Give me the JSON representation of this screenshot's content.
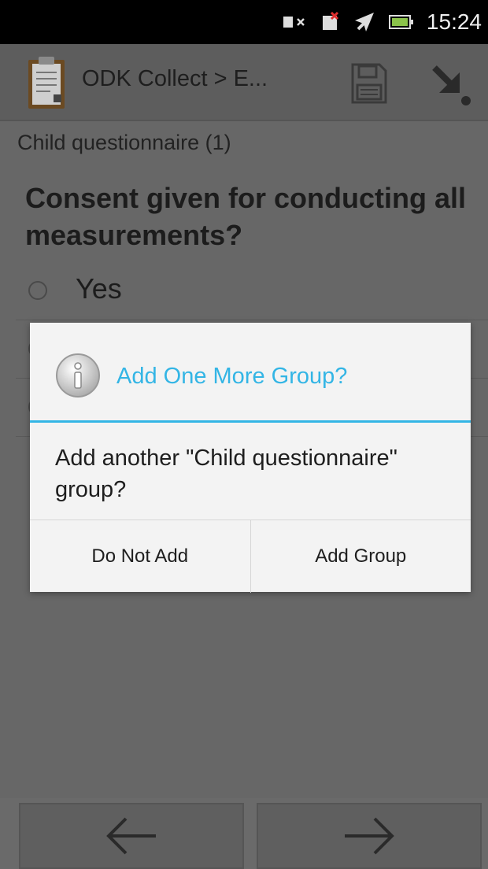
{
  "status_bar": {
    "time": "15:24",
    "icons": [
      "muted-speaker-icon",
      "no-sim-icon",
      "airplane-mode-icon",
      "battery-icon"
    ]
  },
  "action_bar": {
    "title": "ODK Collect > E...",
    "app_icon": "clipboard-icon",
    "save_icon": "save-disk-icon",
    "next_icon": "go-to-end-icon"
  },
  "form": {
    "group_label": "Child questionnaire (1)",
    "question": "Consent given for conducting all measurements?",
    "options": [
      "Yes"
    ]
  },
  "dialog": {
    "icon": "info-icon",
    "title": "Add One More Group?",
    "message": "Add another \"Child questionnaire\" group?",
    "negative_button": "Do Not Add",
    "positive_button": "Add Group",
    "accent_color": "#33b5e5"
  },
  "navigation": {
    "back_icon": "arrow-left-icon",
    "forward_icon": "arrow-right-icon"
  }
}
